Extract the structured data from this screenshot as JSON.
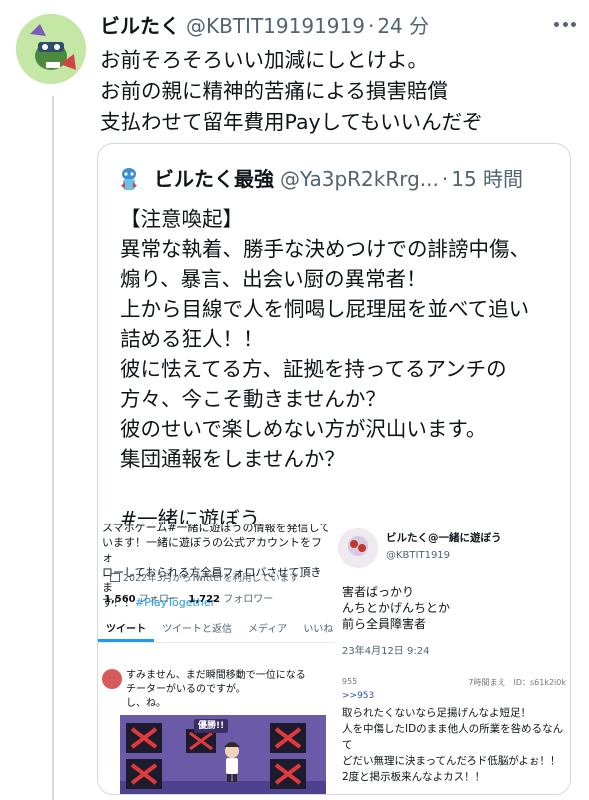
{
  "tweet": {
    "author_name": "ビルたく",
    "handle": "@KBTIT19191919",
    "separator": "·",
    "time": "24 分",
    "text": "お前そろそろいい加減にしとけよ。\nお前の親に精神的苦痛による損害賠償\n支払わせて留年費用Payしてもいいんだぞ"
  },
  "quote": {
    "author_name": "ビルたく最強",
    "handle": "@Ya3pR2kRrg...",
    "separator": "·",
    "time": "15 時間",
    "text": "【注意喚起】\n異常な執着、勝手な決めつけでの誹謗中傷、\n煽り、暴言、出会い厨の異常者！\n上から目線で人を恫喝し屁理屈を並べて追い\n詰める狂人！！\n彼に怯えてる方、証拠を持ってるアンチの\n方々、今こそ動きませんか？\n彼のせいで楽しめない方が沢山います。\n集団通報をしませんか？\n\n#一緒に遊ぼう"
  },
  "media": {
    "profile_panel": {
      "bio_line1": "スマホゲーム#一緒に遊ぼうの情報を発信して",
      "bio_line2": "います！一緒に遊ぼうの公式アカウントをフォ\nローしておられる方全員フォロバさせて頂きま\nす！！",
      "bio_tag": "#PlayTogether",
      "since": "2022年3月からTwitterを利用しています",
      "following_count": "1,560",
      "following_label": "フォロー",
      "followers_count": "1,722",
      "followers_label": "フォロワー",
      "tabs": [
        "ツイート",
        "ツイートと返信",
        "メディア",
        "いいね"
      ]
    },
    "tweet_panel": {
      "name": "ビルたく@一緒に遊ぼう",
      "handle": "@KBTIT1919",
      "text": "害者ばっかり\nんちとかげんちとか\n前ら全員障害者",
      "date": "23年4月12日 9:24"
    },
    "chat_panel": {
      "text": "すみません、まだ瞬間移動で一位になる\nチーターがいるのですが。\nし、ね。",
      "banner": "優勝!!"
    },
    "bbs_panel": {
      "number": "955",
      "meta": "7時間まえ　ID：s61k2i0k",
      "reply": ">>953",
      "text": "取られたくないなら足揚げんなよ短足！\n人を中傷したIDのまま他人の所業を咎めるなん\nて\nどだい無理に決まってんだろド低脳がよぉ！！\n2度と掲示板来んなよカス！！"
    }
  },
  "colors": {
    "text": "#0f1419",
    "secondary": "#536471",
    "accent": "#1d9bf0",
    "border": "#cfd9de"
  }
}
